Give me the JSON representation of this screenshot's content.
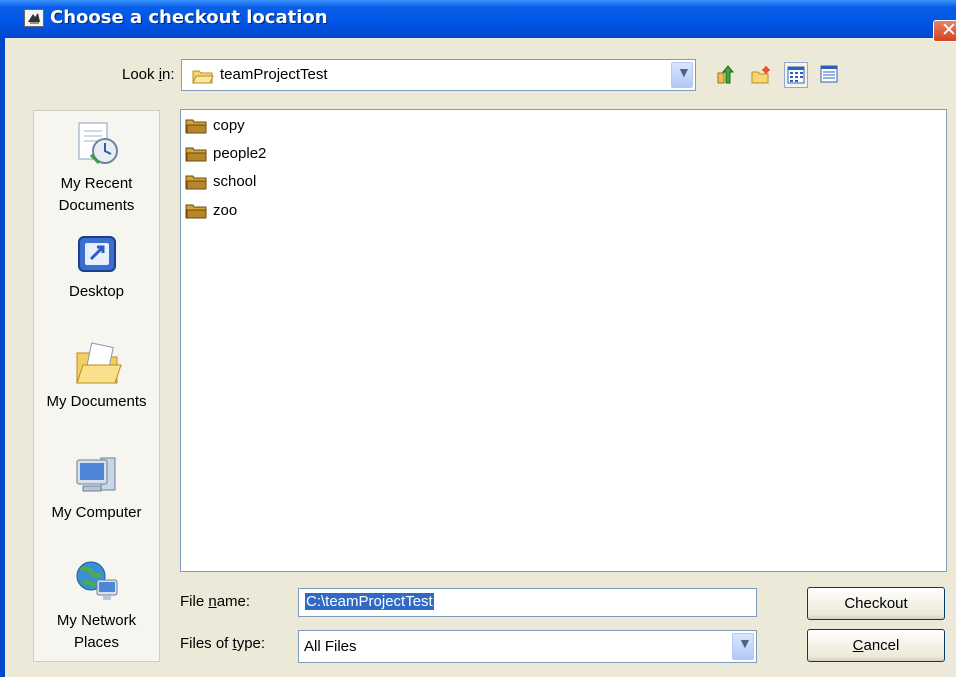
{
  "window": {
    "title": "Choose a checkout location"
  },
  "lookin": {
    "label": "Look in:",
    "value": "teamProjectTest"
  },
  "toolbar": {
    "icons": [
      "up-folder-icon",
      "new-folder-icon",
      "list-view-icon",
      "details-view-icon"
    ],
    "active_view": "list-view"
  },
  "places": [
    {
      "label": "My Recent Documents",
      "line1": "My Recent",
      "line2": "Documents",
      "icon": "recent-documents-icon"
    },
    {
      "label": "Desktop",
      "line1": "Desktop",
      "line2": "",
      "icon": "desktop-icon"
    },
    {
      "label": "My Documents",
      "line1": "My Documents",
      "line2": "",
      "icon": "my-documents-icon"
    },
    {
      "label": "My Computer",
      "line1": "My Computer",
      "line2": "",
      "icon": "my-computer-icon"
    },
    {
      "label": "My Network Places",
      "line1": "My Network",
      "line2": "Places",
      "icon": "network-places-icon"
    }
  ],
  "files": [
    {
      "name": "copy"
    },
    {
      "name": "people2"
    },
    {
      "name": "school"
    },
    {
      "name": "zoo"
    }
  ],
  "filename": {
    "label_before": "File ",
    "label_key": "n",
    "label_after": "ame:",
    "value": "C:\\teamProjectTest"
  },
  "filetype": {
    "label_before": "Files of ",
    "label_key": "t",
    "label_after": "ype:",
    "value": "All Files"
  },
  "buttons": {
    "checkout": "Checkout",
    "cancel_key": "C",
    "cancel_rest": "ancel"
  },
  "colors": {
    "titlebar": "#0055e5",
    "selection": "#316ac5",
    "dialog_bg": "#ece9d8",
    "close": "#d3421f"
  }
}
